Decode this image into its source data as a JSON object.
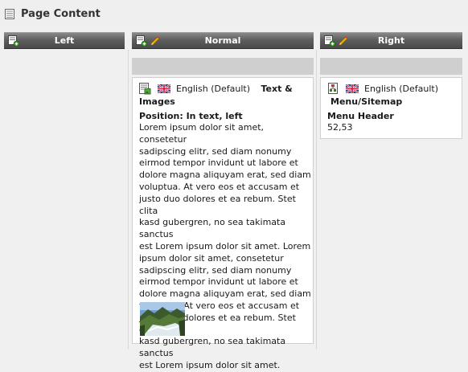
{
  "page": {
    "title": "Page Content"
  },
  "columns": [
    {
      "label": "Left"
    },
    {
      "label": "Normal"
    },
    {
      "label": "Right"
    }
  ],
  "normal_element": {
    "language": "English (Default)",
    "ctype_line1": "Text &",
    "ctype_line2": "Images",
    "position_label": "Position: In text, left",
    "body_lines": [
      "Lorem ipsum dolor sit amet, consetetur",
      "sadipscing elitr, sed diam nonumy",
      "eirmod tempor invidunt ut labore et",
      "dolore magna aliquyam erat, sed diam",
      "voluptua. At vero eos et accusam et",
      "justo duo dolores et ea rebum. Stet clita",
      "kasd gubergren, no sea takimata sanctus",
      "est Lorem ipsum dolor sit amet. Lorem",
      "ipsum dolor sit amet, consetetur",
      "sadipscing elitr, sed diam nonumy",
      "eirmod tempor invidunt ut labore et",
      "dolore magna aliquyam erat, sed diam",
      "voluptua. At vero eos et accusam et",
      "justo duo dolores et ea rebum. Stet clita",
      "kasd gubergren, no sea takimata sanctus",
      "est Lorem ipsum dolor sit amet."
    ],
    "image_icon": "landscape-thumbnail"
  },
  "right_element": {
    "language": "English (Default)",
    "ctype": "Menu/Sitemap",
    "field_label": "Menu Header",
    "field_value": "52,53"
  },
  "colors": {
    "header_dark": "#4a4a4a",
    "dropzone": "#cfcfcf",
    "background": "#f0f0f0"
  }
}
